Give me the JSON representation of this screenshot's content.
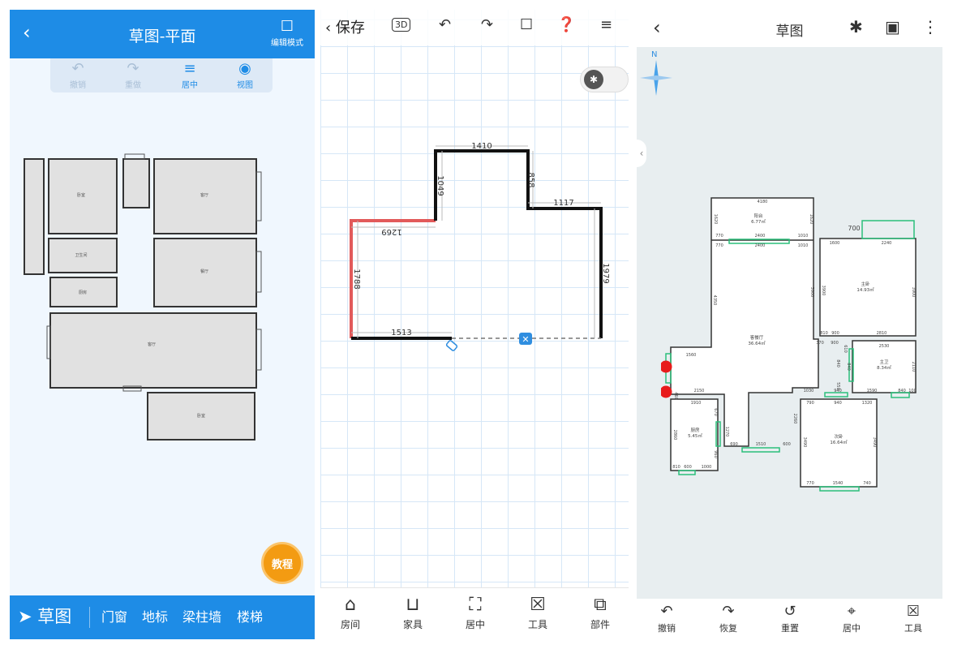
{
  "p1": {
    "title": "草图-平面",
    "edit_mode": "编辑模式",
    "tools": [
      "撤销",
      "重做",
      "居中",
      "视图"
    ],
    "bottom_main": "草图",
    "bottom_items": [
      "门窗",
      "地标",
      "梁柱墙",
      "楼梯"
    ],
    "help": "教程"
  },
  "p2": {
    "save": "保存",
    "icon_3d": "3D",
    "dims": {
      "top": "1410",
      "left_top": "1049",
      "right_drop": "858",
      "right_top": "1117",
      "mid": "1269",
      "left": "1788",
      "bottom": "1513",
      "right": "1979"
    },
    "tabs": [
      "房间",
      "家具",
      "居中",
      "工具",
      "部件"
    ]
  },
  "p3": {
    "title": "草图",
    "compass": "N",
    "rooms": [
      {
        "name": "阳台",
        "area": "6.77㎡"
      },
      {
        "name": "主卧",
        "area": "14.93㎡"
      },
      {
        "name": "客餐厅",
        "area": "36.64㎡"
      },
      {
        "name": "主卫",
        "area": "8.34㎡"
      },
      {
        "name": "厨房",
        "area": "5.45㎡"
      },
      {
        "name": "次卧",
        "area": "16.64㎡"
      }
    ],
    "dims": [
      "4180",
      "1620",
      "1620",
      "770",
      "2400",
      "1010",
      "770",
      "2400",
      "1010",
      "1600",
      "2240",
      "700",
      "3900",
      "3900",
      "4350",
      "3900",
      "810",
      "900",
      "2810",
      "370",
      "900",
      "610",
      "2530",
      "1560",
      "840",
      "840",
      "2110",
      "550",
      "1030",
      "940",
      "1590",
      "840",
      "100",
      "2150",
      "460",
      "1910",
      "670",
      "790",
      "940",
      "1320",
      "2260",
      "1270",
      "690",
      "1510",
      "600",
      "3490",
      "3490",
      "2860",
      "960",
      "810",
      "600",
      "1000",
      "770",
      "1540",
      "740"
    ],
    "tabs": [
      "撤销",
      "恢复",
      "重置",
      "居中",
      "工具"
    ]
  }
}
